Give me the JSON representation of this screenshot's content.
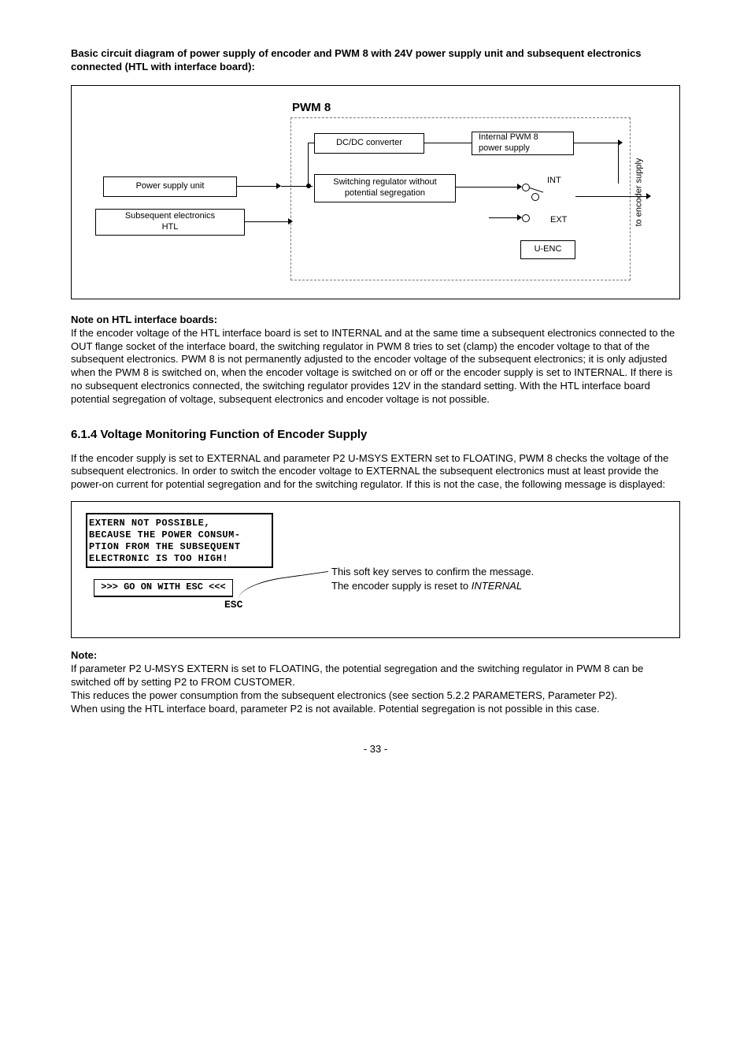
{
  "heading1": "Basic circuit diagram of power supply of encoder and PWM 8 with 24V power supply unit and subsequent electronics connected (HTL with interface board):",
  "diagram": {
    "pwm_title": "PWM 8",
    "psu": "Power supply unit",
    "se_line1": "Subsequent electronics",
    "se_line2": "HTL",
    "dcdc": "DC/DC converter",
    "ipwm_line1": "Internal PWM 8",
    "ipwm_line2": "power supply",
    "swreg_line1": "Switching regulator without",
    "swreg_line2": "potential segregation",
    "int": "INT",
    "ext": "EXT",
    "uenc": "U-ENC",
    "enc_supply": "to encoder supply"
  },
  "note_htl_title": "Note on HTL interface boards:",
  "note_htl_body": "If the encoder voltage of the HTL interface board is set to INTERNAL and at the same time a subsequent electronics connected to the OUT flange socket of the interface board, the switching regulator in PWM 8 tries to set (clamp) the encoder voltage to that of the subsequent electronics. PWM 8 is not permanently adjusted to the encoder voltage of the subsequent electronics; it is only adjusted when the PWM 8 is switched on, when the encoder voltage is switched on or off or the encoder supply is set to INTERNAL. If there is no subsequent electronics connected, the switching regulator provides 12V in the standard setting. With the HTL interface board potential segregation of voltage, subsequent electronics and encoder voltage is not possible.",
  "section_title": "6.1.4 Voltage Monitoring Function of Encoder Supply",
  "section_body": "If the encoder supply is set to EXTERNAL and parameter P2 U-MSYS EXTERN set to FLOATING, PWM 8 checks the voltage of the subsequent electronics. In order to switch the encoder voltage to EXTERNAL the subsequent electronics must at least provide the power-on current for potential segregation and for the switching regulator. If this is not the case, the following message is displayed:",
  "lcd": {
    "l1": "EXTERN NOT POSSIBLE,",
    "l2": "BECAUSE THE POWER CONSUM-",
    "l3": "PTION FROM THE SUBSEQUENT",
    "l4": "ELECTRONIC IS TOO HIGH!"
  },
  "softkey": ">>> GO ON WITH ESC <<<",
  "esc_label": "ESC",
  "msg_note_l1": "This soft key serves to confirm the message.",
  "msg_note_l2_a": "The encoder supply is reset to ",
  "msg_note_l2_b": "INTERNAL",
  "note2_title": "Note:",
  "note2_p1": "If parameter P2 U-MSYS EXTERN is set to FLOATING, the potential segregation and the switching regulator in PWM 8 can be switched off by setting P2 to FROM CUSTOMER.",
  "note2_p2": "This reduces the power consumption from the subsequent electronics (see section 5.2.2 PARAMETERS, Parameter P2).",
  "note2_p3": "When using the HTL interface board, parameter P2 is not available. Potential segregation is not possible in this case.",
  "page": "- 33 -"
}
